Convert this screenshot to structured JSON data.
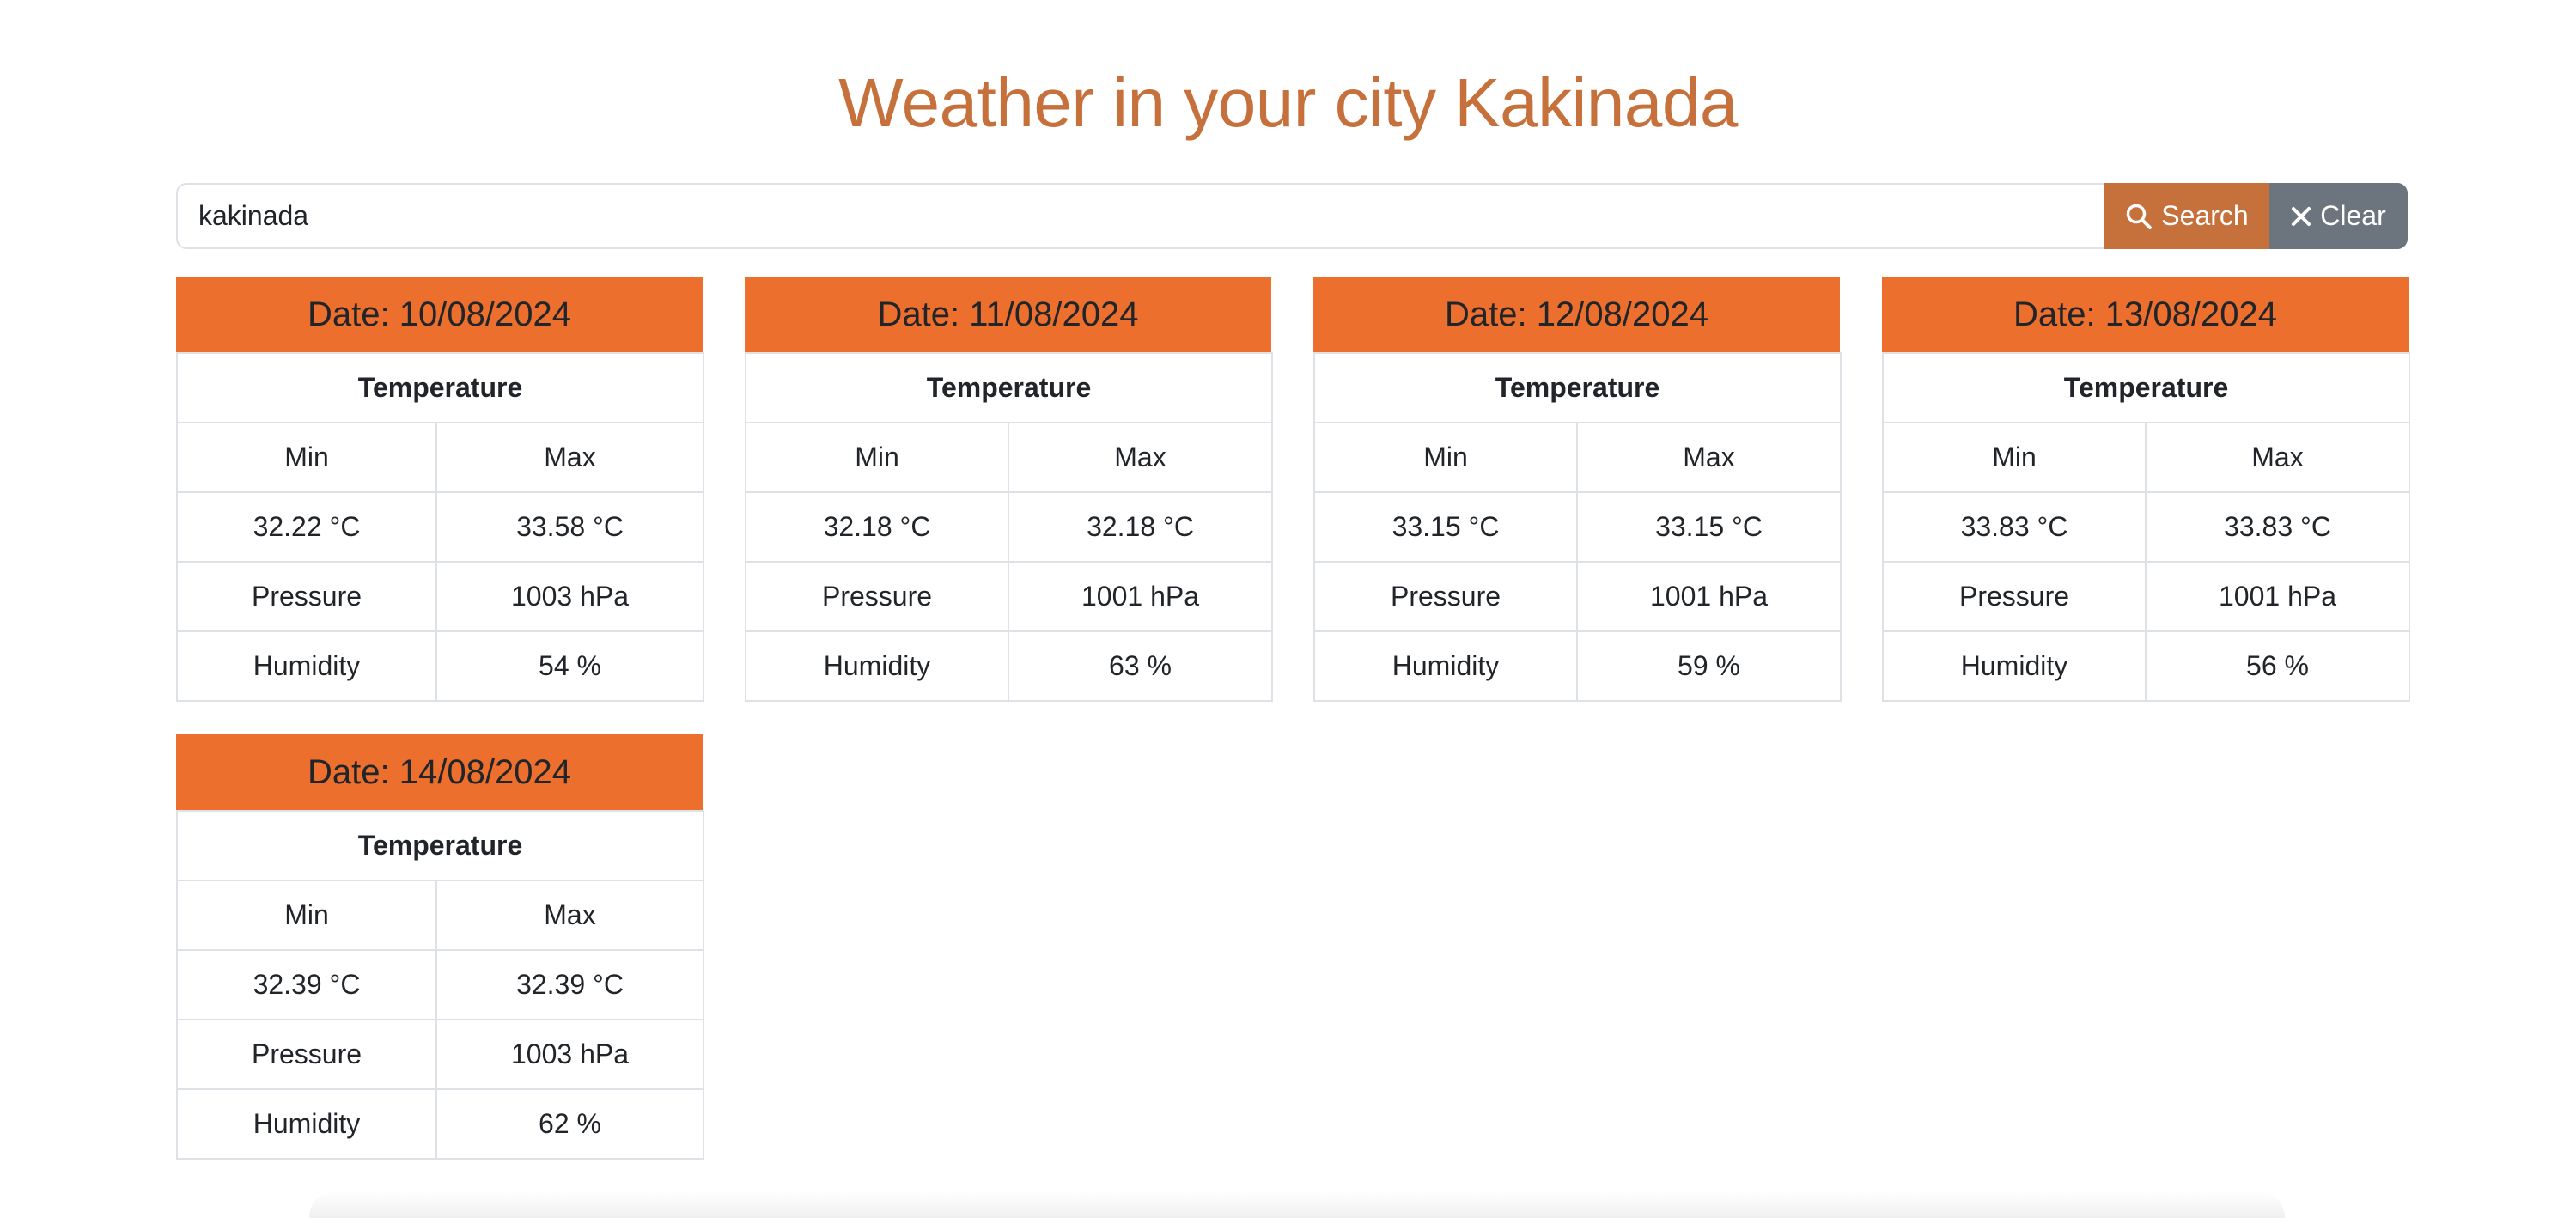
{
  "page": {
    "title": "Weather in your city Kakinada"
  },
  "search": {
    "value": "kakinada",
    "search_label": "Search",
    "clear_label": "Clear",
    "search_icon": "magnifier-icon",
    "clear_icon": "close-icon"
  },
  "colors": {
    "accent": "#c6703b",
    "card_header": "#ec6f2d",
    "clear_button": "#6c757d",
    "border": "#dee2e6"
  },
  "cards": [
    {
      "date": "Date: 10/08/2024",
      "temperature_label": "Temperature",
      "min_label": "Min",
      "max_label": "Max",
      "min": "32.22 °C",
      "max": "33.58 °C",
      "pressure_label": "Pressure",
      "pressure": "1003 hPa",
      "humidity_label": "Humidity",
      "humidity": "54 %"
    },
    {
      "date": "Date: 11/08/2024",
      "temperature_label": "Temperature",
      "min_label": "Min",
      "max_label": "Max",
      "min": "32.18 °C",
      "max": "32.18 °C",
      "pressure_label": "Pressure",
      "pressure": "1001 hPa",
      "humidity_label": "Humidity",
      "humidity": "63 %"
    },
    {
      "date": "Date: 12/08/2024",
      "temperature_label": "Temperature",
      "min_label": "Min",
      "max_label": "Max",
      "min": "33.15 °C",
      "max": "33.15 °C",
      "pressure_label": "Pressure",
      "pressure": "1001 hPa",
      "humidity_label": "Humidity",
      "humidity": "59 %"
    },
    {
      "date": "Date: 13/08/2024",
      "temperature_label": "Temperature",
      "min_label": "Min",
      "max_label": "Max",
      "min": "33.83 °C",
      "max": "33.83 °C",
      "pressure_label": "Pressure",
      "pressure": "1001 hPa",
      "humidity_label": "Humidity",
      "humidity": "56 %"
    },
    {
      "date": "Date: 14/08/2024",
      "temperature_label": "Temperature",
      "min_label": "Min",
      "max_label": "Max",
      "min": "32.39 °C",
      "max": "32.39 °C",
      "pressure_label": "Pressure",
      "pressure": "1003 hPa",
      "humidity_label": "Humidity",
      "humidity": "62 %"
    }
  ]
}
